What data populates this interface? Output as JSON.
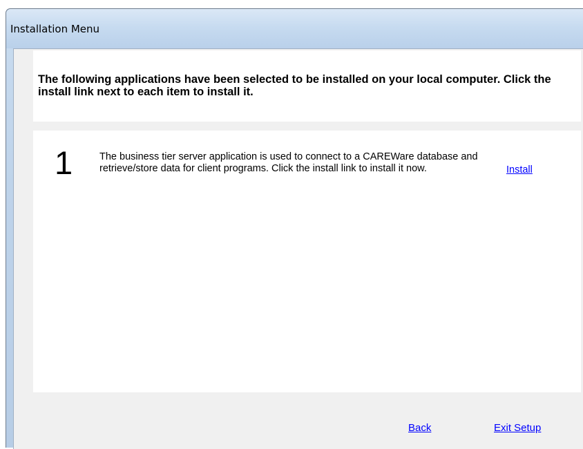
{
  "window": {
    "title": "Installation Menu"
  },
  "header": {
    "instructions": "The following applications have been selected to be installed on your local computer. Click the install link next to each item to install it."
  },
  "items": [
    {
      "number": "1",
      "description": "The business tier server application is used to connect to a CAREWare database and retrieve/store data for client programs. Click the install link to install it now.",
      "link_label": "Install"
    }
  ],
  "footer": {
    "back_label": "Back",
    "exit_label": "Exit Setup"
  },
  "colors": {
    "link": "#0000ff",
    "panel": "#ffffff",
    "dialog_background": "#f0f0f0"
  }
}
